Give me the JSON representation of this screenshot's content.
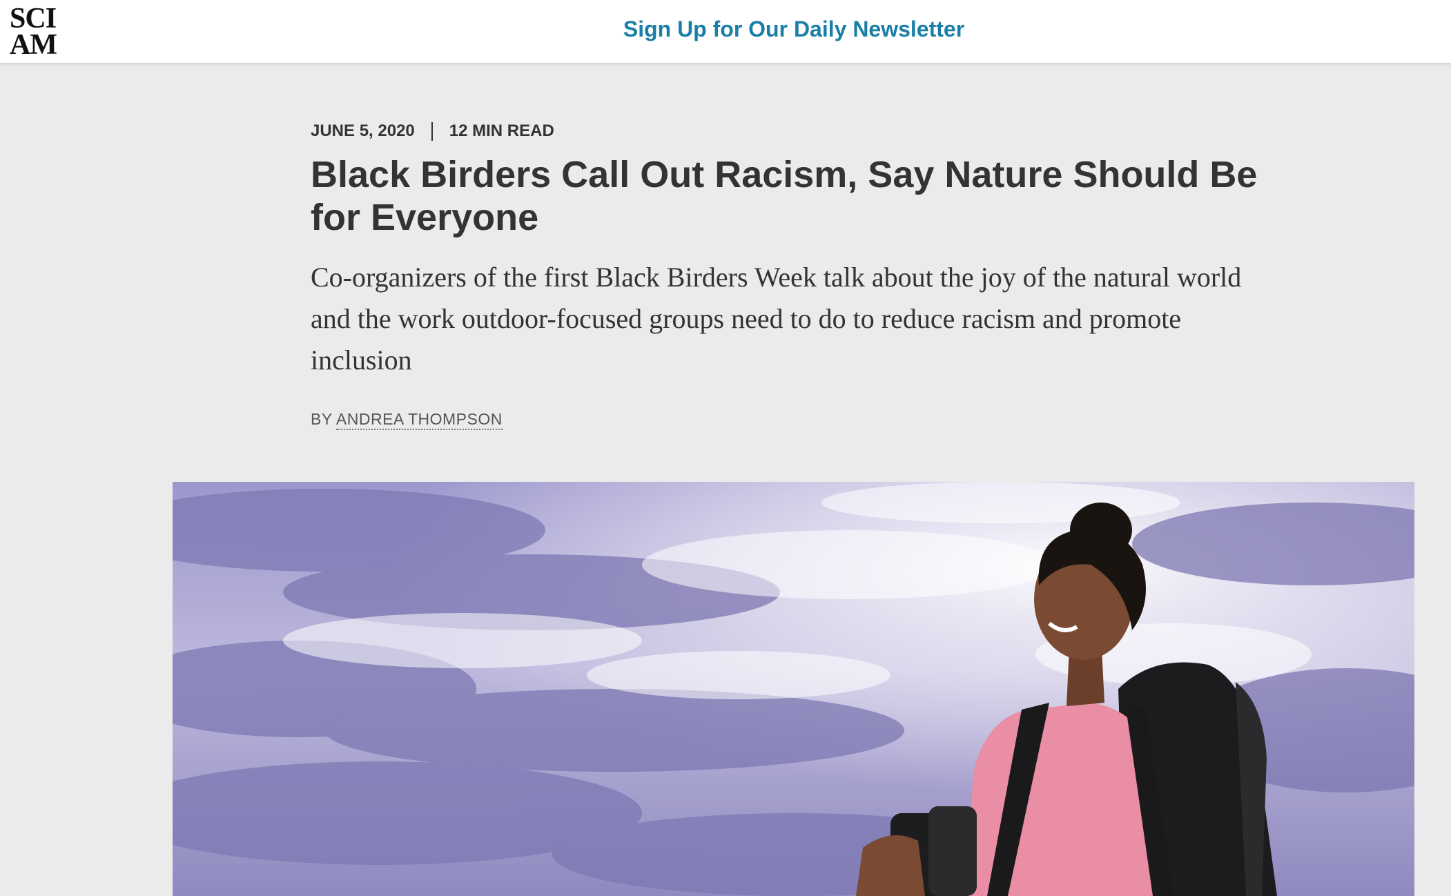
{
  "header": {
    "logo_line1": "SCI",
    "logo_line2": "AM",
    "newsletter_label": "Sign Up for Our Daily Newsletter"
  },
  "article": {
    "date": "JUNE 5, 2020",
    "read_time": "12 MIN READ",
    "headline": "Black Birders Call Out Racism, Say Nature Should Be for Everyone",
    "dek": "Co-organizers of the first Black Birders Week talk about the joy of the natural world and the work outdoor-focused groups need to do to reduce racism and promote inclusion",
    "byline_prefix": "BY",
    "author": "ANDREA THOMPSON"
  },
  "colors": {
    "page_background": "#ebebeb",
    "link_accent": "#1a7fa6",
    "text": "#333333",
    "shirt": "#e98ea4",
    "sky": "#8b86bd"
  }
}
